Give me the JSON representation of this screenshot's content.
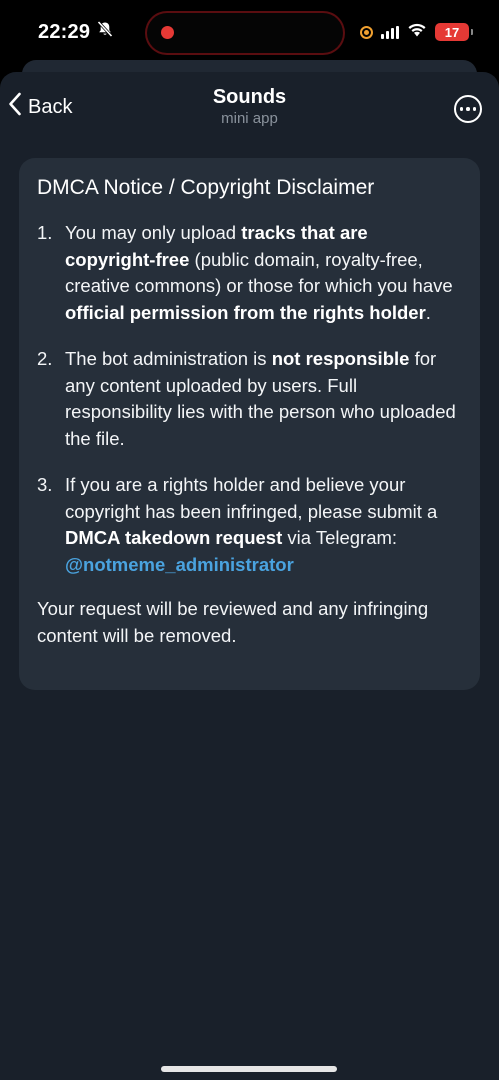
{
  "status_bar": {
    "time": "22:29",
    "battery": "17"
  },
  "nav": {
    "back_label": "Back",
    "title": "Sounds",
    "subtitle": "mini app"
  },
  "card": {
    "title": "DMCA Notice / Copyright Disclaimer",
    "items": [
      {
        "number": "1.",
        "parts": [
          "You may only upload ",
          "tracks that are copyright-free",
          " (public domain, royalty-free, creative commons) or those for which you have ",
          "official permission from the rights holder",
          "."
        ]
      },
      {
        "number": "2.",
        "parts": [
          "The bot administration is ",
          "not responsible",
          " for any content uploaded by users. Full responsibility lies with the person who uploaded the file."
        ]
      },
      {
        "number": "3.",
        "parts": [
          "If you are a rights holder and believe your copyright has been infringed, please submit a ",
          "DMCA takedown request",
          " via Telegram: ",
          "@notmeme_administrator"
        ]
      }
    ],
    "footer": "Your request will be reviewed and any infringing content will be removed."
  },
  "colors": {
    "background": "#000000",
    "sheet": "#19202a",
    "card": "#262f3a",
    "link": "#4aa3df",
    "battery_low": "#e53935",
    "recording": "#e53935"
  },
  "icons": [
    "silent-bell-icon",
    "recording-dot-icon",
    "privacy-indicator-icon",
    "cellular-signal-icon",
    "wifi-icon",
    "battery-icon",
    "back-chevron-icon",
    "more-icon"
  ]
}
